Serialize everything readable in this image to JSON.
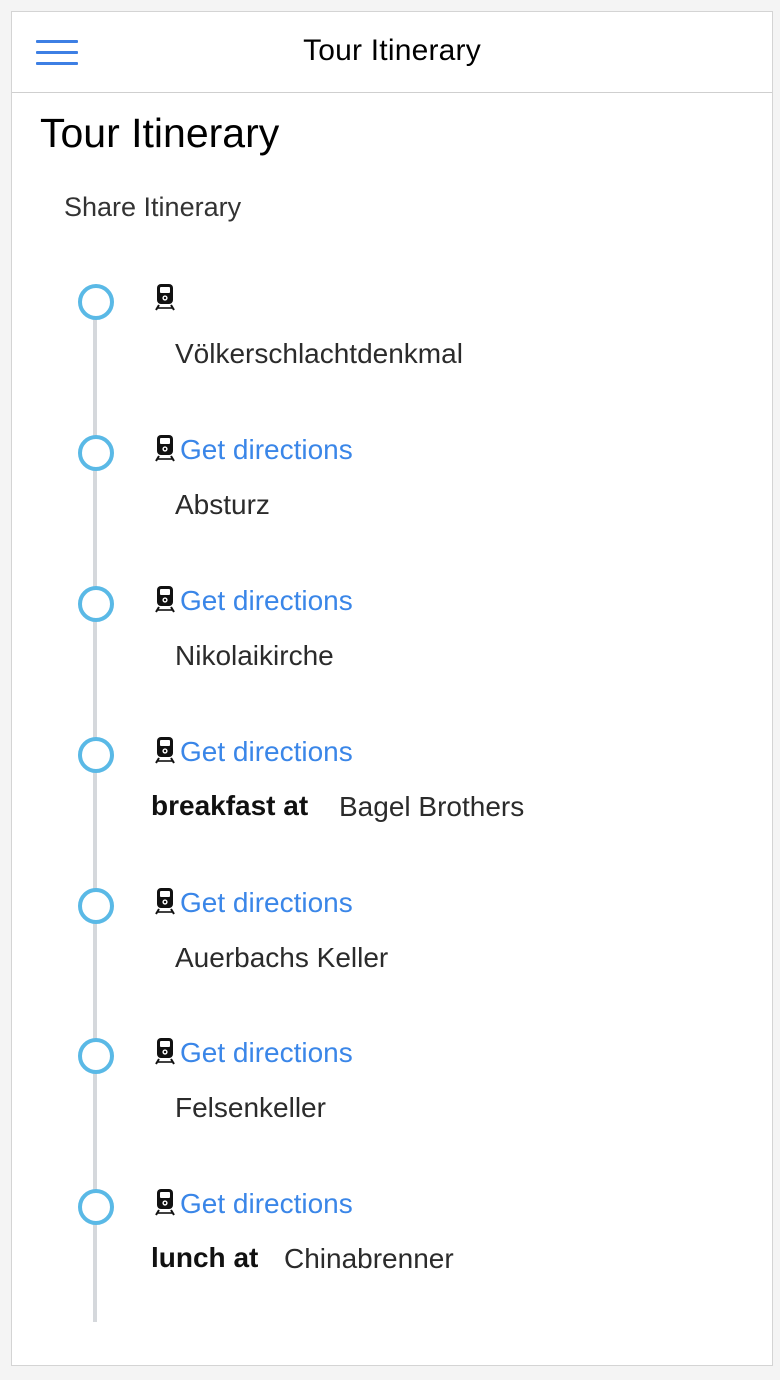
{
  "header": {
    "title": "Tour Itinerary",
    "menu_icon": "hamburger-menu-icon",
    "accent_color": "#3d7fe4"
  },
  "page": {
    "heading": "Tour Itinerary",
    "share_label": "Share Itinerary"
  },
  "timeline": {
    "circle_color": "#5ab9e6",
    "link_color": "#3a86e8",
    "transport_icon": "train-icon",
    "stops": [
      {
        "directions": "",
        "prefix": "",
        "name": "Völkerschlachtdenkmal"
      },
      {
        "directions": "Get directions",
        "prefix": "",
        "name": "Absturz"
      },
      {
        "directions": "Get directions",
        "prefix": "",
        "name": "Nikolaikirche"
      },
      {
        "directions": "Get directions",
        "prefix": "breakfast at",
        "name": "Bagel Brothers"
      },
      {
        "directions": "Get directions",
        "prefix": "",
        "name": "Auerbachs Keller"
      },
      {
        "directions": "Get directions",
        "prefix": "",
        "name": "Felsenkeller"
      },
      {
        "directions": "Get directions",
        "prefix": "lunch at",
        "name": "Chinabrenner"
      }
    ]
  }
}
